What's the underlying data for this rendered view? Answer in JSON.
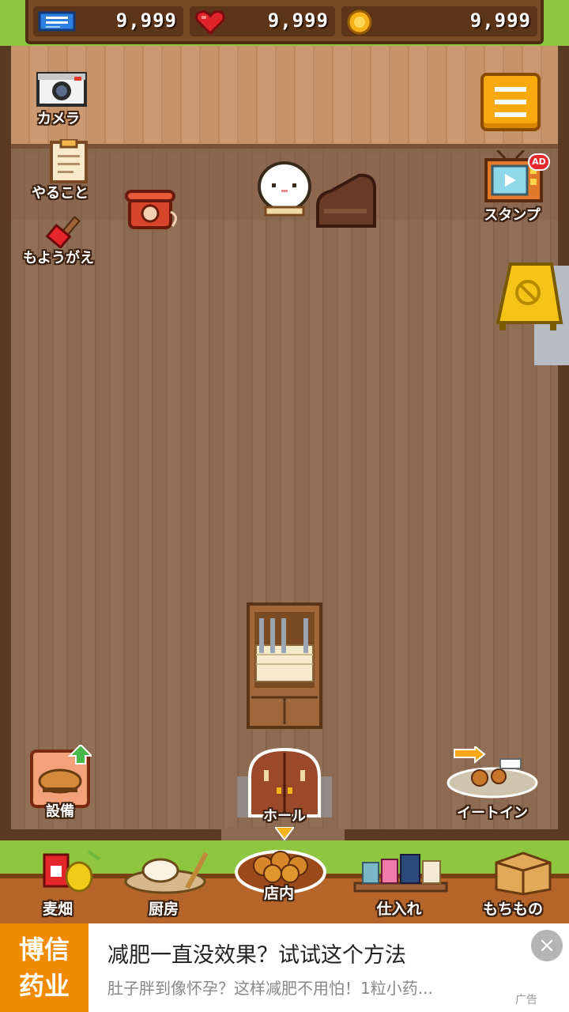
{
  "resources": {
    "tickets": "9,999",
    "hearts": "9,999",
    "coins": "9,999"
  },
  "left_menu": {
    "camera": "カメラ",
    "todo": "やること",
    "redecorate": "もようがえ"
  },
  "right_menu": {
    "stamp": "スタンプ",
    "stamp_badge": "AD"
  },
  "room": {
    "equipment": "設備",
    "hall": "ホール",
    "eat_in": "イートイン"
  },
  "nav": {
    "items": [
      {
        "label": "麦畑",
        "icon": "wheat-field-icon"
      },
      {
        "label": "厨房",
        "icon": "kitchen-icon"
      },
      {
        "label": "店内",
        "icon": "bread-basket-icon"
      },
      {
        "label": "仕入れ",
        "icon": "stock-shelf-icon"
      },
      {
        "label": "もちもの",
        "icon": "box-icon"
      }
    ]
  },
  "ad": {
    "logo_line1": "博信",
    "logo_line2": "药业",
    "title": "减肥一直没效果？试试这个方法",
    "subtitle": "肚子胖到像怀孕？这样减肥不用怕！1粒小药...",
    "tag": "广告",
    "close": "×"
  },
  "colors": {
    "grass": "#8ec63f",
    "wood_dark": "#7a4a22",
    "menu_orange": "#f7a90e",
    "ad_orange": "#f08a00"
  }
}
